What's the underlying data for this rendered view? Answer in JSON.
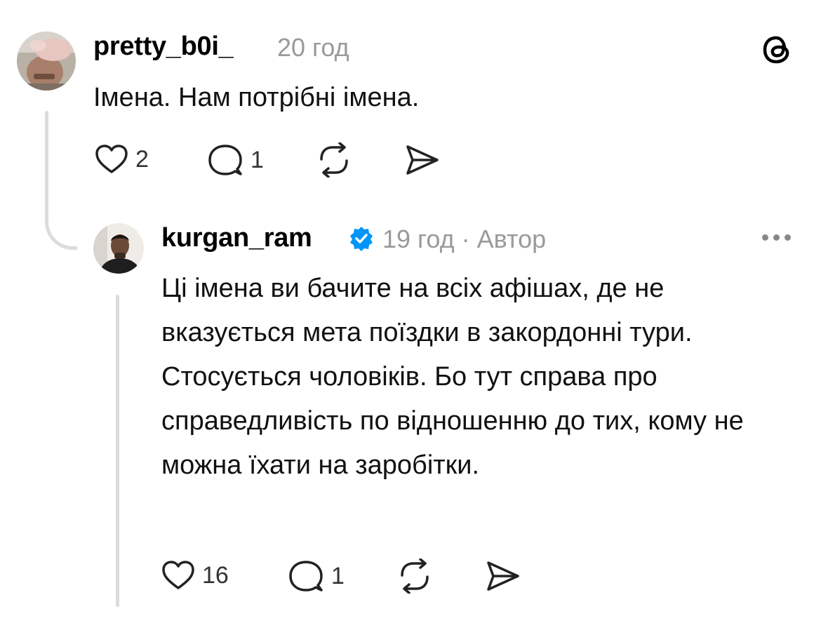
{
  "comments": [
    {
      "username": "pretty_b0i_",
      "time": "20 год",
      "text": "Імена. Нам потрібні імена.",
      "likes": "2",
      "replies": "1",
      "avatar_icon": "user-avatar-photo"
    },
    {
      "username": "kurgan_ram",
      "verified": true,
      "time": "19 год",
      "separator": "·",
      "role": "Автор",
      "paragraphs": [
        "Ці імена ви бачите на всіх афішах, де не вказується мета поїздки в закордонні тури.",
        "Стосується чоловіків. Бо тут справа про справедливість по відношенню до тих, кому не можна їхати на заробітки."
      ],
      "likes": "16",
      "replies": "1",
      "avatar_icon": "user-avatar-photo"
    }
  ],
  "colors": {
    "verified_badge": "#0095f6",
    "meta_text": "#9a9a9a",
    "thread_line": "#dcdcdc"
  },
  "icons": [
    "threads-logo-icon",
    "heart-icon",
    "comment-icon",
    "repost-icon",
    "share-icon",
    "more-icon",
    "verified-badge-icon"
  ]
}
